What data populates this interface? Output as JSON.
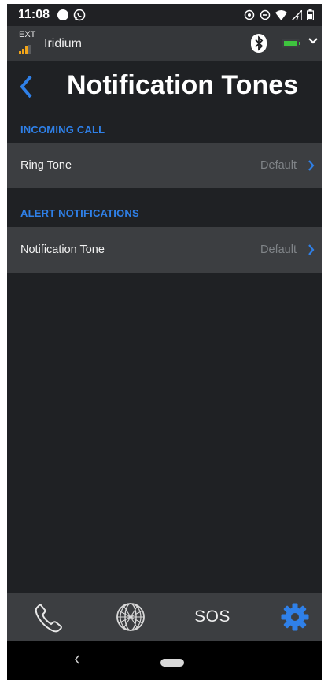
{
  "status_bar": {
    "time": "11:08",
    "icons": [
      "circle-dot-icon",
      "whatsapp-icon",
      "target-icon",
      "do-not-disturb-icon",
      "wifi-icon",
      "cell-signal-icon",
      "battery-icon"
    ]
  },
  "app_bar": {
    "ext_label": "EXT",
    "network_name": "Iridium",
    "icons": [
      "signal-bars-icon",
      "bluetooth-icon",
      "battery-icon",
      "chevron-down-icon"
    ]
  },
  "header": {
    "title": "Notification Tones",
    "back_icon": "back-chevron-icon"
  },
  "sections": [
    {
      "title": "INCOMING CALL",
      "rows": [
        {
          "label": "Ring Tone",
          "value": "Default"
        }
      ]
    },
    {
      "title": "ALERT NOTIFICATIONS",
      "rows": [
        {
          "label": "Notification Tone",
          "value": "Default"
        }
      ]
    }
  ],
  "tab_bar": {
    "tabs": [
      {
        "icon": "phone-icon",
        "active": false
      },
      {
        "icon": "globe-icon",
        "active": false
      },
      {
        "label": "SOS",
        "active": false
      },
      {
        "icon": "gear-icon",
        "active": true
      }
    ]
  },
  "colors": {
    "accent": "#2f80e8",
    "background": "#1f2124",
    "row_background": "#3c3e41",
    "value_text": "#808488"
  }
}
